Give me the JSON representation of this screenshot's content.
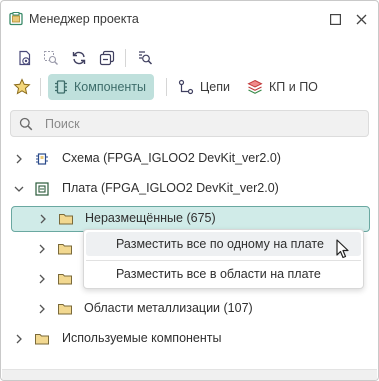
{
  "window": {
    "title": "Менеджер проекта"
  },
  "tabs": [
    {
      "label": "Компоненты",
      "active": true
    },
    {
      "label": "Цепи",
      "active": false
    },
    {
      "label": "КП и ПО",
      "active": false
    }
  ],
  "search": {
    "placeholder": "Поиск",
    "value": ""
  },
  "tree": {
    "items": [
      {
        "label": "Схема (FPGA_IGLOO2 DevKit_ver2.0)",
        "expanded": false,
        "icon": "schematic-icon"
      },
      {
        "label": "Плата (FPGA_IGLOO2 DevKit_ver2.0)",
        "expanded": true,
        "icon": "board-icon"
      },
      {
        "label": "Неразмещённые (675)",
        "expanded": false,
        "icon": "folder-icon",
        "selected": true
      },
      {
        "label": "",
        "icon": "folder-icon"
      },
      {
        "label": "",
        "icon": "folder-icon"
      },
      {
        "label": "Области металлизации (107)",
        "expanded": false,
        "icon": "folder-icon"
      },
      {
        "label": "Используемые компоненты",
        "expanded": false,
        "icon": "folder-icon"
      }
    ]
  },
  "context_menu": {
    "items": [
      {
        "label": "Разместить все по одному на плате",
        "hovered": true
      },
      {
        "label": "Разместить все в области на плате",
        "hovered": false
      }
    ]
  },
  "colors": {
    "accent": "#bfe0dc",
    "accent_text": "#3d6c6a",
    "selection_border": "#6aa8a1",
    "folder": "#e9c97a"
  }
}
